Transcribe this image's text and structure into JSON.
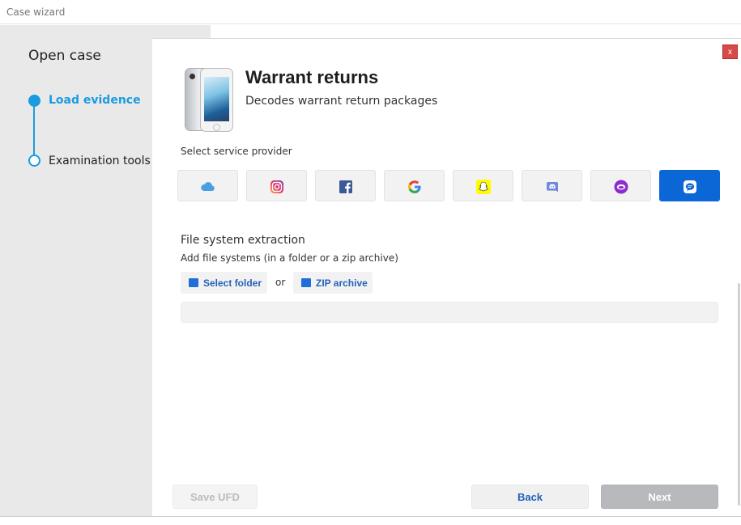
{
  "window": {
    "title": "Case wizard",
    "close_label": "x"
  },
  "sidebar": {
    "heading": "Open case",
    "steps": [
      {
        "label": "Load evidence",
        "state": "active"
      },
      {
        "label": "Examination tools",
        "state": "pending"
      }
    ]
  },
  "header": {
    "title": "Warrant returns",
    "subtitle": "Decodes warrant return packages",
    "image_icon": "iphone-image"
  },
  "providers": {
    "label": "Select service provider",
    "items": [
      {
        "icon": "icloud-icon",
        "selected": false
      },
      {
        "icon": "instagram-icon",
        "selected": false
      },
      {
        "icon": "facebook-icon",
        "selected": false
      },
      {
        "icon": "google-icon",
        "selected": false
      },
      {
        "icon": "snapchat-icon",
        "selected": false
      },
      {
        "icon": "discord-icon",
        "selected": false
      },
      {
        "icon": "kik-icon",
        "selected": false
      },
      {
        "icon": "chat-bubble-icon",
        "selected": true
      }
    ]
  },
  "file_system": {
    "title": "File system extraction",
    "subtitle": "Add file systems (in a folder or a zip archive)",
    "select_folder_label": "Select folder",
    "or_label": "or",
    "zip_archive_label": "ZIP archive"
  },
  "footer": {
    "save_label": "Save UFD",
    "back_label": "Back",
    "next_label": "Next"
  },
  "colors": {
    "accent": "#1a9be0",
    "selected_provider": "#0b66d6",
    "link": "#2462b7",
    "sidebar_bg": "#e9e9e9"
  }
}
